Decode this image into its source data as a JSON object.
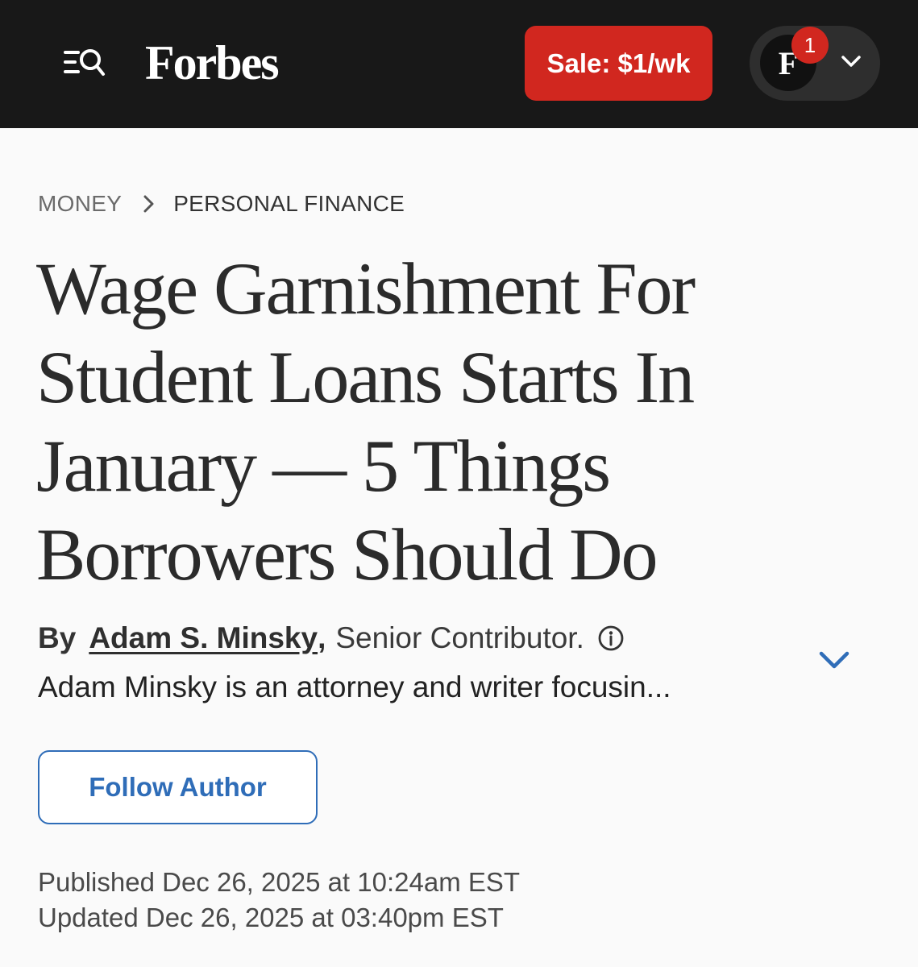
{
  "header": {
    "logo": "Forbes",
    "menu_icon": "menu-search-icon",
    "sale_label": "Sale: $1/wk",
    "account": {
      "avatar_initial": "F",
      "notification_count": "1",
      "chevron_icon": "chevron-down-icon"
    },
    "colors": {
      "bar": "#181818",
      "sale": "#d1271f",
      "badge": "#d1271f"
    }
  },
  "breadcrumb": {
    "section": "MONEY",
    "separator_icon": "chevron-right-icon",
    "subsection": "PERSONAL FINANCE"
  },
  "article": {
    "headline": "Wage Garnishment For Student Loans Starts In January — 5 Things Borrowers Should Do",
    "byline": {
      "prefix": "By",
      "author": "Adam S. Minsky",
      "comma": ",",
      "role": "Senior Contributor.",
      "info_icon": "info-icon",
      "bio": "Adam Minsky is an attorney and writer focusin...",
      "expand_icon": "chevron-down-icon"
    },
    "follow_label": "Follow Author",
    "published": "Published Dec 26, 2025 at 10:24am EST",
    "updated": "Updated Dec 26, 2025 at 03:40pm EST",
    "accent_color": "#2f6db8"
  }
}
